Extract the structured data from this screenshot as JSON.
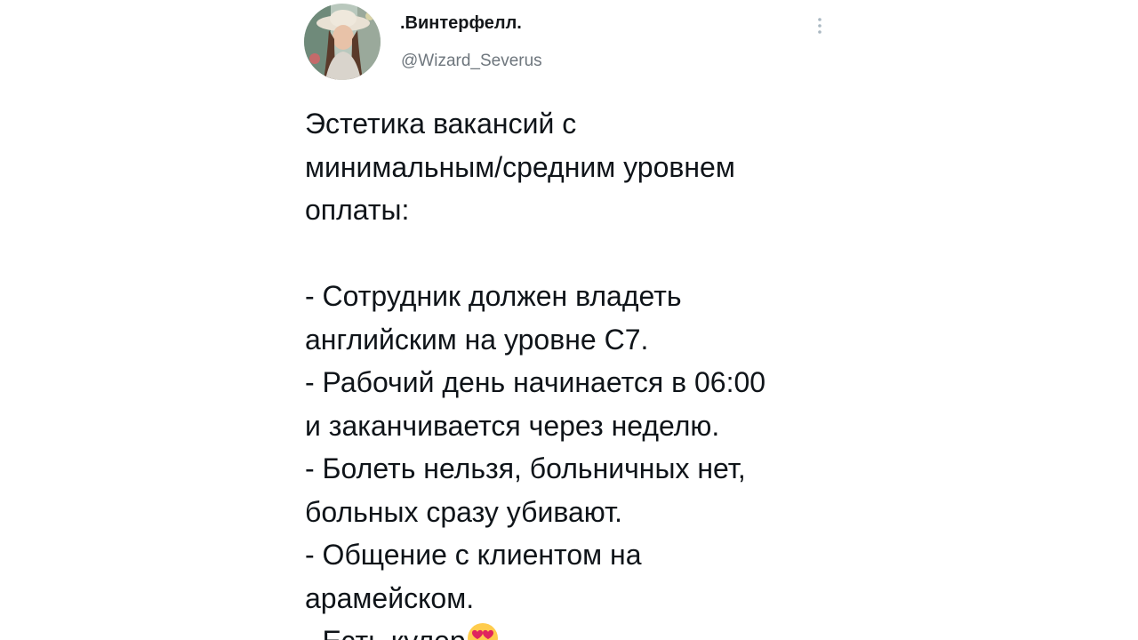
{
  "tweet": {
    "author": {
      "display_name": ".Винтерфелл.",
      "handle": "@Wizard_Severus",
      "avatar_icon": "profile-photo-avatar"
    },
    "more_icon": "vertical-dots-icon",
    "lines": [
      "Эстетика вакансий с",
      "минимальным/средним уровнем",
      "оплаты:",
      "",
      "- Сотрудник должен владеть",
      "английским на уровне С7.",
      "- Рабочий день начинается в 06:00",
      "и заканчивается через неделю.",
      "- Болеть нельзя, больничных нет,",
      "больных сразу убивают.",
      "- Общение с клиентом на",
      "арамейском.",
      "- Есть кулер"
    ],
    "last_line_emoji": "heart-eyes-emoji"
  }
}
